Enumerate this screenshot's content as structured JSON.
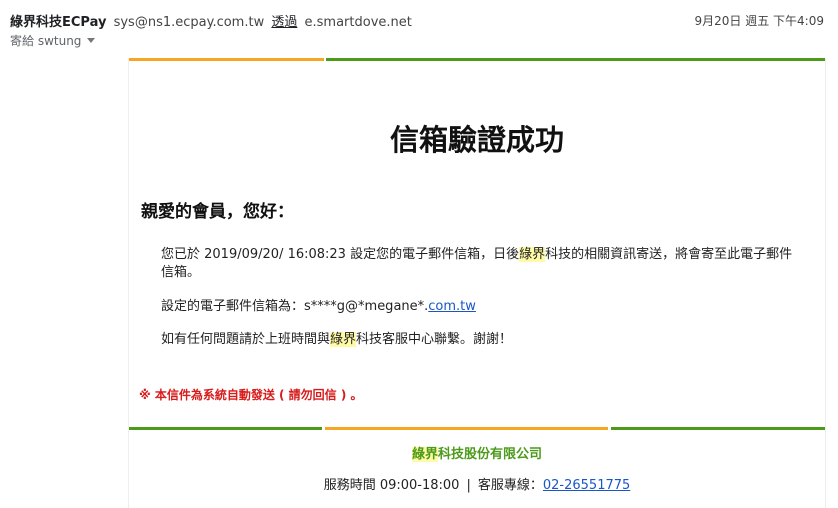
{
  "header": {
    "sender_name": "綠界科技ECPay",
    "sender_email": "sys@ns1.ecpay.com.tw",
    "via_label": "透過",
    "via_domain": "e.smartdove.net",
    "date": "9月20日 週五 下午4:09",
    "recipient_label": "寄給 swtung"
  },
  "email": {
    "title": "信箱驗證成功",
    "greeting": "親愛的會員，您好：",
    "p1_before": "您已於 2019/09/20/ 16:08:23 設定您的電子郵件信箱，日後",
    "p1_highlight": "綠界",
    "p1_after": "科技的相關資訊寄送，將會寄至此電子郵件信箱。",
    "p2_label": "設定的電子郵件信箱為：s****g@*megane*.",
    "p2_link": "com.tw",
    "p3_before": "如有任何問題請於上班時間與",
    "p3_highlight": "綠界",
    "p3_after": "科技客服中心聯繫。謝謝！",
    "notice": "※ 本信件為系統自動發送 ( 請勿回信 ) 。",
    "company_highlight": "綠界",
    "company_rest": "科技股份有限公司",
    "service_hours": "服務時間 09:00-18:00",
    "service_sep": "|",
    "service_label": "客服專線：",
    "service_phone": "02-26551775"
  },
  "colors": {
    "accent_orange": "#f5a623",
    "accent_green": "#4c9a1a",
    "notice_red": "#d81b1b",
    "link_blue": "#1a56c8",
    "highlight_yellow": "#fffaa6"
  }
}
